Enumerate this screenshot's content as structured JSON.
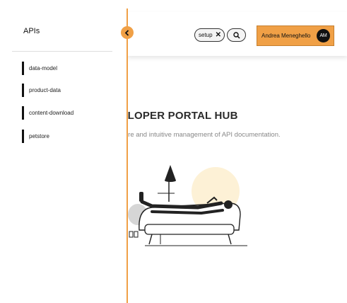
{
  "sidebar": {
    "title": "APIs",
    "items": [
      {
        "label": "data-model"
      },
      {
        "label": "product-data"
      },
      {
        "label": "content-download"
      },
      {
        "label": "petstore"
      }
    ]
  },
  "header": {
    "filter_chip": "setup",
    "user": {
      "name": "Andrea Meneghello",
      "initials": "AM"
    }
  },
  "hero": {
    "title": "EVELOPER PORTAL HUB",
    "subtitle": "or secure and intuitive management of API documentation."
  },
  "colors": {
    "accent": "#f0a046",
    "text": "#222222",
    "muted": "#888888"
  },
  "icons": {
    "collapse": "chevron-left-icon",
    "search": "search-icon",
    "remove": "close-icon"
  }
}
